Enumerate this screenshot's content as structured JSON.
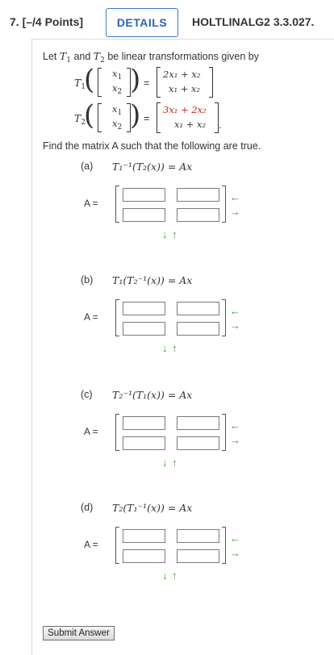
{
  "header": {
    "question_number": "7.",
    "points": "[–/4 Points]",
    "details_label": "DETAILS",
    "problem_code": "HOLTLINALG2 3.3.027."
  },
  "intro": {
    "text_prefix": "Let",
    "t1": "T",
    "t1_sub": "1",
    "and": "and",
    "t2": "T",
    "t2_sub": "2",
    "text_suffix": "be linear transformations given by"
  },
  "definitions": {
    "t1": {
      "name": "T",
      "sub": "1",
      "input": [
        "x",
        "1",
        "x",
        "2"
      ],
      "output_row1": "2x₁ + x₂",
      "output_row2": "x₁ + x₂",
      "equals": "="
    },
    "t2": {
      "name": "T",
      "sub": "2",
      "input": [
        "x",
        "1",
        "x",
        "2"
      ],
      "output_row1": "3x₁ + 2x₂",
      "output_row2": "x₁ + x₂",
      "equals": "=",
      "period": "."
    }
  },
  "instruction": "Find the matrix A such that the following are true.",
  "parts": [
    {
      "label": "(a)",
      "expression": "T₁⁻¹(T₂(x)) = Ax",
      "a_label": "A ="
    },
    {
      "label": "(b)",
      "expression": "T₁(T₂⁻¹(x)) = Ax",
      "a_label": "A ="
    },
    {
      "label": "(c)",
      "expression": "T₂⁻¹(T₁(x)) = Ax",
      "a_label": "A ="
    },
    {
      "label": "(d)",
      "expression": "T₂(T₁⁻¹(x)) = Ax",
      "a_label": "A ="
    }
  ],
  "matrix_cells": [
    "",
    "",
    "",
    ""
  ],
  "icons": {
    "col_arrows": "↕-arrows-icon",
    "row_arrows": "↔-arrows-icon",
    "arrow_left": "←",
    "arrow_right": "→",
    "arrow_down": "↓",
    "arrow_up": "↑"
  },
  "colors": {
    "accent": "#2a64b5",
    "arrow_green": "#3aa02f",
    "highlight_red": "#cc1f1f"
  },
  "submit_label": "Submit Answer"
}
